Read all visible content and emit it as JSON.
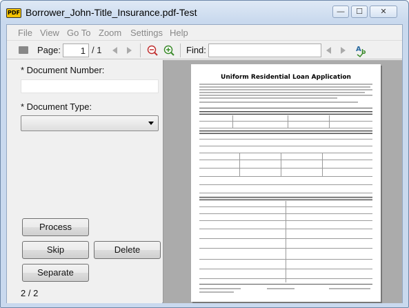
{
  "window": {
    "title": "Borrower_John-Title_Insurance.pdf-Test",
    "app_icon_label": "PDF",
    "minimize_glyph": "—",
    "maximize_glyph": "☐",
    "close_glyph": "✕"
  },
  "menu": [
    "File",
    "View",
    "Go To",
    "Zoom",
    "Settings",
    "Help"
  ],
  "toolbar": {
    "page_label": "Page:",
    "page_value": "1",
    "page_total": "/ 1",
    "find_label": "Find:",
    "find_value": ""
  },
  "form": {
    "document_number_label": "* Document Number:",
    "document_number_value": "",
    "document_type_label": "* Document Type:",
    "document_type_value": ""
  },
  "buttons": {
    "process": "Process",
    "skip": "Skip",
    "delete": "Delete",
    "separate": "Separate"
  },
  "status": "2 / 2",
  "document": {
    "title": "Uniform Residential Loan Application"
  }
}
